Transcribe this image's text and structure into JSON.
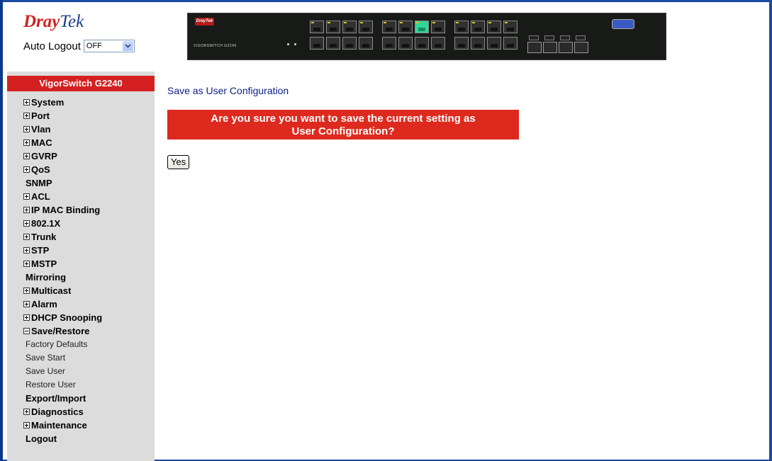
{
  "header": {
    "logo_primary": "Dray",
    "logo_secondary": "Tek",
    "auto_logout_label": "Auto Logout",
    "auto_logout_value": "OFF"
  },
  "switch_image": {
    "brand": "DrayTek",
    "model": "VIGORSWITCH G2240"
  },
  "sidebar": {
    "title": "VigorSwitch G2240",
    "items": [
      {
        "label": "System",
        "icon": "plus-box-icon"
      },
      {
        "label": "Port",
        "icon": "plus-box-icon"
      },
      {
        "label": "Vlan",
        "icon": "plus-box-icon"
      },
      {
        "label": "MAC",
        "icon": "plus-box-icon"
      },
      {
        "label": "GVRP",
        "icon": "plus-box-icon"
      },
      {
        "label": "QoS",
        "icon": "plus-box-icon"
      },
      {
        "label": "SNMP",
        "icon": ""
      },
      {
        "label": "ACL",
        "icon": "plus-box-icon"
      },
      {
        "label": "IP MAC Binding",
        "icon": "plus-box-icon"
      },
      {
        "label": "802.1X",
        "icon": "plus-box-icon"
      },
      {
        "label": "Trunk",
        "icon": "plus-box-icon"
      },
      {
        "label": "STP",
        "icon": "plus-box-icon"
      },
      {
        "label": "MSTP",
        "icon": "plus-box-icon"
      },
      {
        "label": "Mirroring",
        "icon": ""
      },
      {
        "label": "Multicast",
        "icon": "plus-box-icon"
      },
      {
        "label": "Alarm",
        "icon": "plus-box-icon"
      },
      {
        "label": "DHCP Snooping",
        "icon": "plus-box-icon"
      },
      {
        "label": "Save/Restore",
        "icon": "minus-box-icon"
      }
    ],
    "subitems": [
      "Factory Defaults",
      "Save Start",
      "Save User",
      "Restore User"
    ],
    "items_after": [
      {
        "label": "Export/Import",
        "icon": ""
      },
      {
        "label": "Diagnostics",
        "icon": "plus-box-icon"
      },
      {
        "label": "Maintenance",
        "icon": "plus-box-icon"
      },
      {
        "label": "Logout",
        "icon": ""
      }
    ]
  },
  "main": {
    "title": "Save as User Configuration",
    "warning_line1": "Are you sure you want to save the current setting as",
    "warning_line2": "User Configuration?",
    "yes_label": "Yes"
  },
  "colors": {
    "brand_red": "#d42020",
    "title_blue": "#10208a",
    "sidebar_bg": "#dcdcdc"
  }
}
